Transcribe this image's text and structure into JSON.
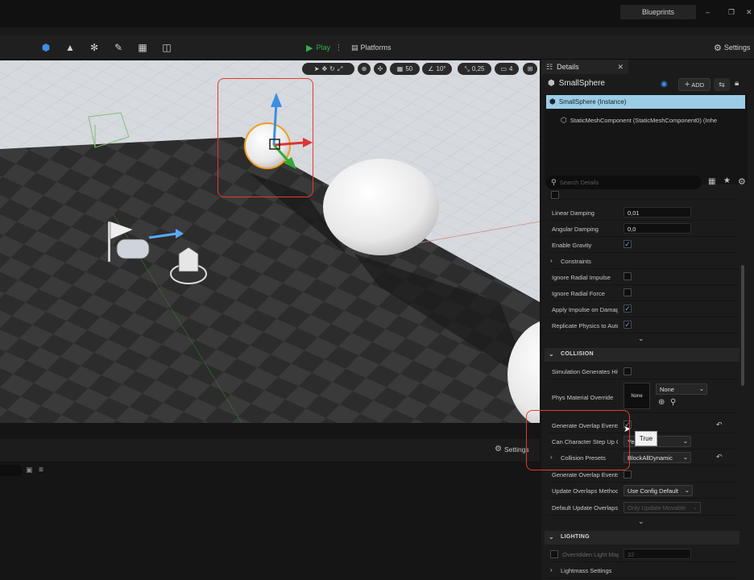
{
  "title_bar": {
    "blueprints_label": "Blueprints",
    "minimize_glyph": "–",
    "maximize_glyph": "❐",
    "close_glyph": "✕"
  },
  "toolbar": {
    "play_label": "Play",
    "platforms_label": "Platforms",
    "settings_label": "Settings"
  },
  "viewport_toolbar": {
    "grid_snap": "50",
    "rotation_snap": "10°",
    "scale_snap": "0,25",
    "camera_speed": "4"
  },
  "details": {
    "tab_label": "Details",
    "actor_name": "SmallSphere",
    "add_button": "ADD",
    "component_instance": "SmallSphere (Instance)",
    "component_child": "StaticMeshComponent (StaticMeshComponent0) (Inhe",
    "search_placeholder": "Search Details",
    "properties": [
      {
        "label": "Linear Damping",
        "value": "0,01"
      },
      {
        "label": "Angular Damping",
        "value": "0,0"
      },
      {
        "label": "Enable Gravity"
      },
      {
        "label": "Constraints"
      },
      {
        "label": "Ignore Radial Impulse"
      },
      {
        "label": "Ignore Radial Force"
      },
      {
        "label": "Apply Impulse on Damage"
      },
      {
        "label": "Replicate Physics to Autonomous Proxy"
      }
    ],
    "collision": {
      "section_title": "COLLISION",
      "simulation_generates_hit": "Simulation Generates Hit Events",
      "phys_material_override": "Phys Material Override",
      "phys_material_thumb": "None",
      "phys_material_value": "None",
      "generate_overlap_events": "Generate Overlap Events",
      "tooltip": "True",
      "can_character_step_up": "Can Character Step Up On",
      "can_character_step_up_value": "Yes",
      "collision_presets": "Collision Presets",
      "collision_presets_value": "BlockAllDynamic",
      "generate_overlap_events_2": "Generate Overlap Events During Level Streaming",
      "update_overlaps_method": "Update Overlaps Method During Level Streaming",
      "update_overlaps_value": "Use Config Default",
      "default_update_overlaps": "Default Update Overlaps Method During Level Streaming",
      "default_update_overlaps_value": "Only Update Movable"
    },
    "lighting": {
      "section_title": "LIGHTING",
      "overridden_light_map": "Overridden Light Map Res",
      "overridden_light_map_value": "32",
      "lightmass_settings": "Lightmass Settings"
    }
  },
  "bottom_panel": {
    "settings_label": "Settings"
  },
  "colors": {
    "accent_blue": "#3e8ee0",
    "play_green": "#35b04a",
    "highlight_red": "#e23c2e",
    "selected_row": "#9ccde6"
  }
}
